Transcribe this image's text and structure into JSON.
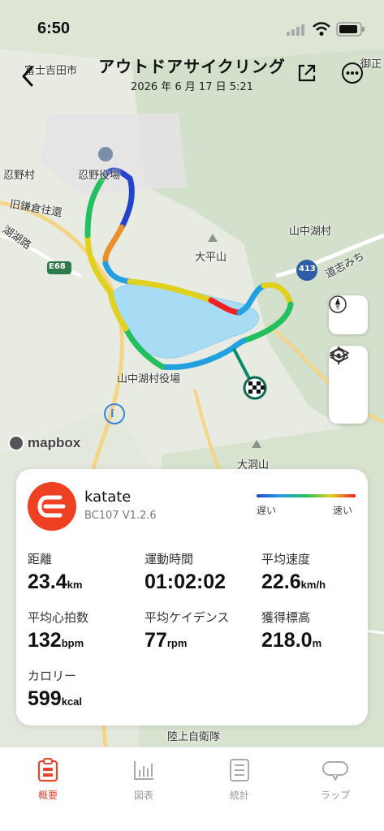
{
  "status_bar": {
    "time": "6:50"
  },
  "header": {
    "title": "アウトドアサイクリング",
    "date": "2026 年 6 月 17 日 5:21"
  },
  "map": {
    "attribution": "mapbox",
    "labels": {
      "fujiyoshida": "富士吉田市",
      "oshino_mura": "忍野村",
      "oshino_station": "忍野役場",
      "kyu_kamakura": "旧鎌倉往還",
      "kosuji": "湖湖路",
      "e68": "E68",
      "oohirayama": "大平山",
      "yamanakako_mura": "山中湖村",
      "doshi_michi": "道志みち",
      "r413": "413",
      "yamanakako_office": "山中湖村役場",
      "ohorayama": "大洞山",
      "rikujo": "陸上自衛隊",
      "misaka": "御正"
    }
  },
  "device": {
    "name": "katate",
    "version": "BC107  V1.2.6"
  },
  "legend": {
    "slow": "遅い",
    "fast": "速い",
    "brand_color": "#ee4023"
  },
  "stats": {
    "distance": {
      "label": "距離",
      "value": "23.4",
      "unit": "km"
    },
    "moving_time": {
      "label": "運動時間",
      "value": "01:02:02",
      "unit": ""
    },
    "avg_speed": {
      "label": "平均速度",
      "value": "22.6",
      "unit": "km/h"
    },
    "avg_hr": {
      "label": "平均心拍数",
      "value": "132",
      "unit": "bpm"
    },
    "avg_cadence": {
      "label": "平均ケイデンス",
      "value": "77",
      "unit": "rpm"
    },
    "elevation": {
      "label": "獲得標高",
      "value": "218.0",
      "unit": "m"
    },
    "calories": {
      "label": "カロリー",
      "value": "599",
      "unit": "kcal"
    }
  },
  "tabs": [
    {
      "label": "概要",
      "icon": "summary-icon",
      "active": true
    },
    {
      "label": "図表",
      "icon": "chart-icon",
      "active": false
    },
    {
      "label": "統計",
      "icon": "stats-icon",
      "active": false
    },
    {
      "label": "ラップ",
      "icon": "lap-icon",
      "active": false
    }
  ]
}
